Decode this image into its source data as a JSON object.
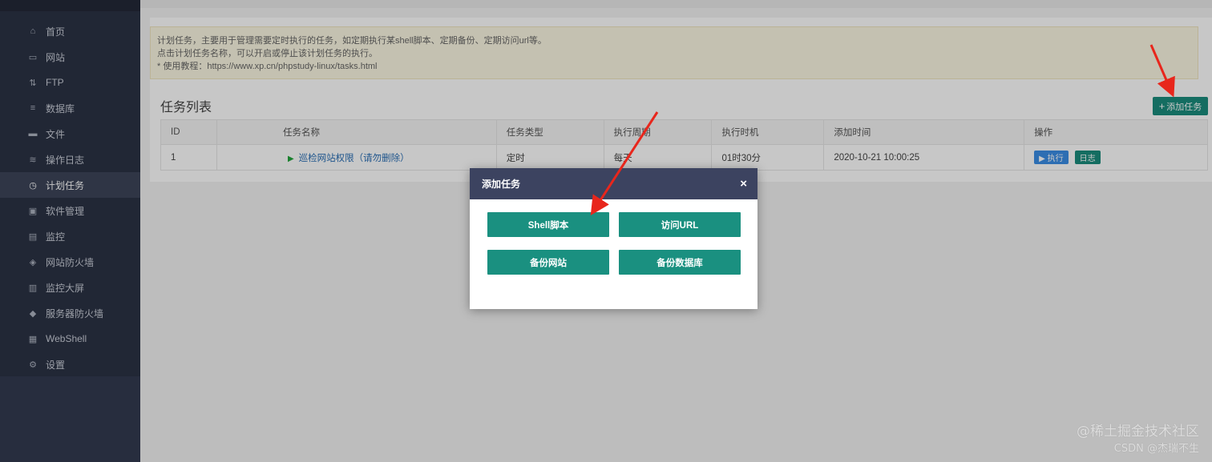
{
  "sidebar": {
    "items": [
      {
        "label": "首页",
        "icon": "home-icon",
        "glyph": "⌂"
      },
      {
        "label": "网站",
        "icon": "monitor-icon",
        "glyph": "▭"
      },
      {
        "label": "FTP",
        "icon": "ftp-icon",
        "glyph": "⇅"
      },
      {
        "label": "数据库",
        "icon": "database-icon",
        "glyph": "≡"
      },
      {
        "label": "文件",
        "icon": "folder-icon",
        "glyph": "▬"
      },
      {
        "label": "操作日志",
        "icon": "log-icon",
        "glyph": "≋"
      },
      {
        "label": "计划任务",
        "icon": "clock-icon",
        "glyph": "◷"
      },
      {
        "label": "软件管理",
        "icon": "software-icon",
        "glyph": "▣"
      },
      {
        "label": "监控",
        "icon": "monitor-chart-icon",
        "glyph": "▤"
      },
      {
        "label": "网站防火墙",
        "icon": "shield-icon",
        "glyph": "◈"
      },
      {
        "label": "监控大屏",
        "icon": "screen-icon",
        "glyph": "▥"
      },
      {
        "label": "服务器防火墙",
        "icon": "server-shield-icon",
        "glyph": "◆"
      },
      {
        "label": "WebShell",
        "icon": "terminal-icon",
        "glyph": "▦"
      },
      {
        "label": "设置",
        "icon": "gear-icon",
        "glyph": "⚙"
      }
    ],
    "active_index": 6
  },
  "notice": {
    "line1": "计划任务，主要用于管理需要定时执行的任务，如定期执行某shell脚本、定期备份、定期访问url等。",
    "line2": "点击计划任务名称，可以开启或停止该计划任务的执行。",
    "line3": "* 使用教程：https://www.xp.cn/phpstudy-linux/tasks.html"
  },
  "section_title": "任务列表",
  "add_task_label": "添加任务",
  "table": {
    "headers": [
      "ID",
      "任务名称",
      "任务类型",
      "执行周期",
      "执行时机",
      "添加时间",
      "操作"
    ],
    "rows": [
      {
        "id": "1",
        "name": "巡检网站权限（请勿删除）",
        "type": "定时",
        "cycle": "每天",
        "time": "01时30分",
        "added": "2020-10-21 10:00:25",
        "run_label": "▶ 执行",
        "log_label": "日志"
      }
    ]
  },
  "modal": {
    "title": "添加任务",
    "close": "×",
    "buttons": [
      "Shell脚本",
      "访问URL",
      "备份网站",
      "备份数据库"
    ]
  },
  "watermark": {
    "line1": "@稀土掘金技术社区",
    "line2": "CSDN @杰瑞不生"
  },
  "colors": {
    "accent": "#1a8c7d",
    "sidebar": "#2b3245",
    "modal_header": "#3c4360",
    "arrow": "#e8261c"
  }
}
